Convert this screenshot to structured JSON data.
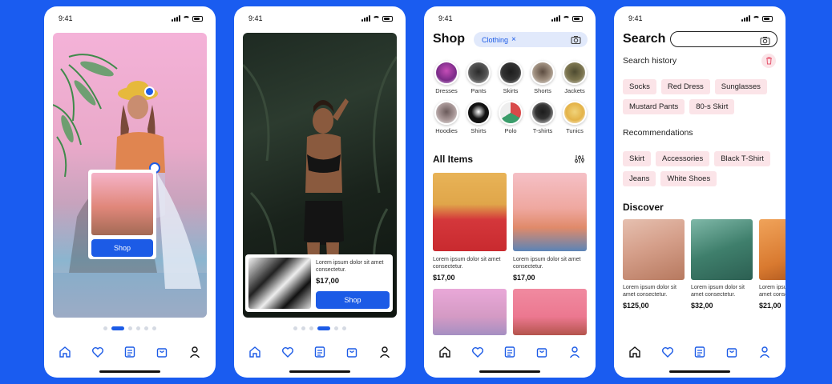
{
  "status": {
    "time": "9:41"
  },
  "screen1": {
    "shop_button": "Shop"
  },
  "screen2": {
    "product": {
      "description": "Lorem ipsum dolor sit amet consectetur.",
      "price": "$17,00"
    },
    "shop_button": "Shop"
  },
  "screen3": {
    "title": "Shop",
    "filter_chip": "Clothing",
    "categories": [
      "Dresses",
      "Pants",
      "Skirts",
      "Shorts",
      "Jackets",
      "Hoodies",
      "Shirts",
      "Polo",
      "T-shirts",
      "Tunics"
    ],
    "all_items_title": "All Items",
    "items": [
      {
        "description": "Lorem ipsum dolor sit amet consectetur.",
        "price": "$17,00"
      },
      {
        "description": "Lorem ipsum dolor sit amet consectetur.",
        "price": "$17,00"
      }
    ]
  },
  "screen4": {
    "title": "Search",
    "search_placeholder": "",
    "history_title": "Search history",
    "history": [
      "Socks",
      "Red Dress",
      "Sunglasses",
      "Mustard Pants",
      "80-s Skirt"
    ],
    "recommendations_title": "Recommendations",
    "recommendations": [
      "Skirt",
      "Accessories",
      "Black T-Shirt",
      "Jeans",
      "White Shoes"
    ],
    "discover_title": "Discover",
    "discover": [
      {
        "description": "Lorem ipsum dolor sit amet consectetur.",
        "price": "$125,00"
      },
      {
        "description": "Lorem ipsum dolor sit amet consectetur.",
        "price": "$32,00"
      },
      {
        "description": "Lorem ipsum dolor sit amet consectetur.",
        "price": "$21,00"
      }
    ]
  },
  "colors": {
    "accent": "#1c5be6",
    "background": "#1a5cf0",
    "tag_bg": "#fbe4e8"
  },
  "pagination": {
    "screen1_active": 1,
    "screen2_active": 3,
    "count": 6
  }
}
